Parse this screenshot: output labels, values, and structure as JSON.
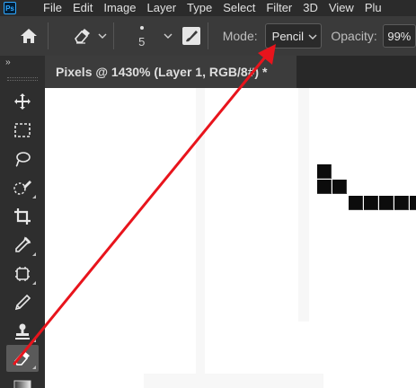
{
  "app": {
    "logo_text": "Ps",
    "brand_color": "#31a8ff"
  },
  "menu": [
    "File",
    "Edit",
    "Image",
    "Layer",
    "Type",
    "Select",
    "Filter",
    "3D",
    "View",
    "Plu"
  ],
  "options": {
    "brush_size": "5",
    "mode_label": "Mode:",
    "mode_value": "Pencil",
    "opacity_label": "Opacity:",
    "opacity_value": "99%"
  },
  "document_tab": {
    "title": "Pixels @ 1430% (Layer 1, RGB/8#) *"
  },
  "toolbar": {
    "collapse_label": "››",
    "tools": [
      {
        "name": "move-tool",
        "icon": "move-icon"
      },
      {
        "name": "marquee-tool",
        "icon": "marquee-icon"
      },
      {
        "name": "lasso-tool",
        "icon": "lasso-icon"
      },
      {
        "name": "quick-selection-tool",
        "icon": "quick-selection-icon"
      },
      {
        "name": "crop-tool",
        "icon": "crop-icon"
      },
      {
        "name": "eyedropper-tool",
        "icon": "eyedropper-icon"
      },
      {
        "name": "spot-healing-tool",
        "icon": "spot-healing-icon"
      },
      {
        "name": "brush-tool",
        "icon": "brush-icon"
      },
      {
        "name": "clone-stamp-tool",
        "icon": "clone-stamp-icon"
      },
      {
        "name": "eraser-tool",
        "icon": "eraser-icon",
        "active": true
      },
      {
        "name": "gradient-tool",
        "icon": "gradient-icon"
      }
    ]
  },
  "annotation": {
    "arrow_color": "#e8141c"
  }
}
